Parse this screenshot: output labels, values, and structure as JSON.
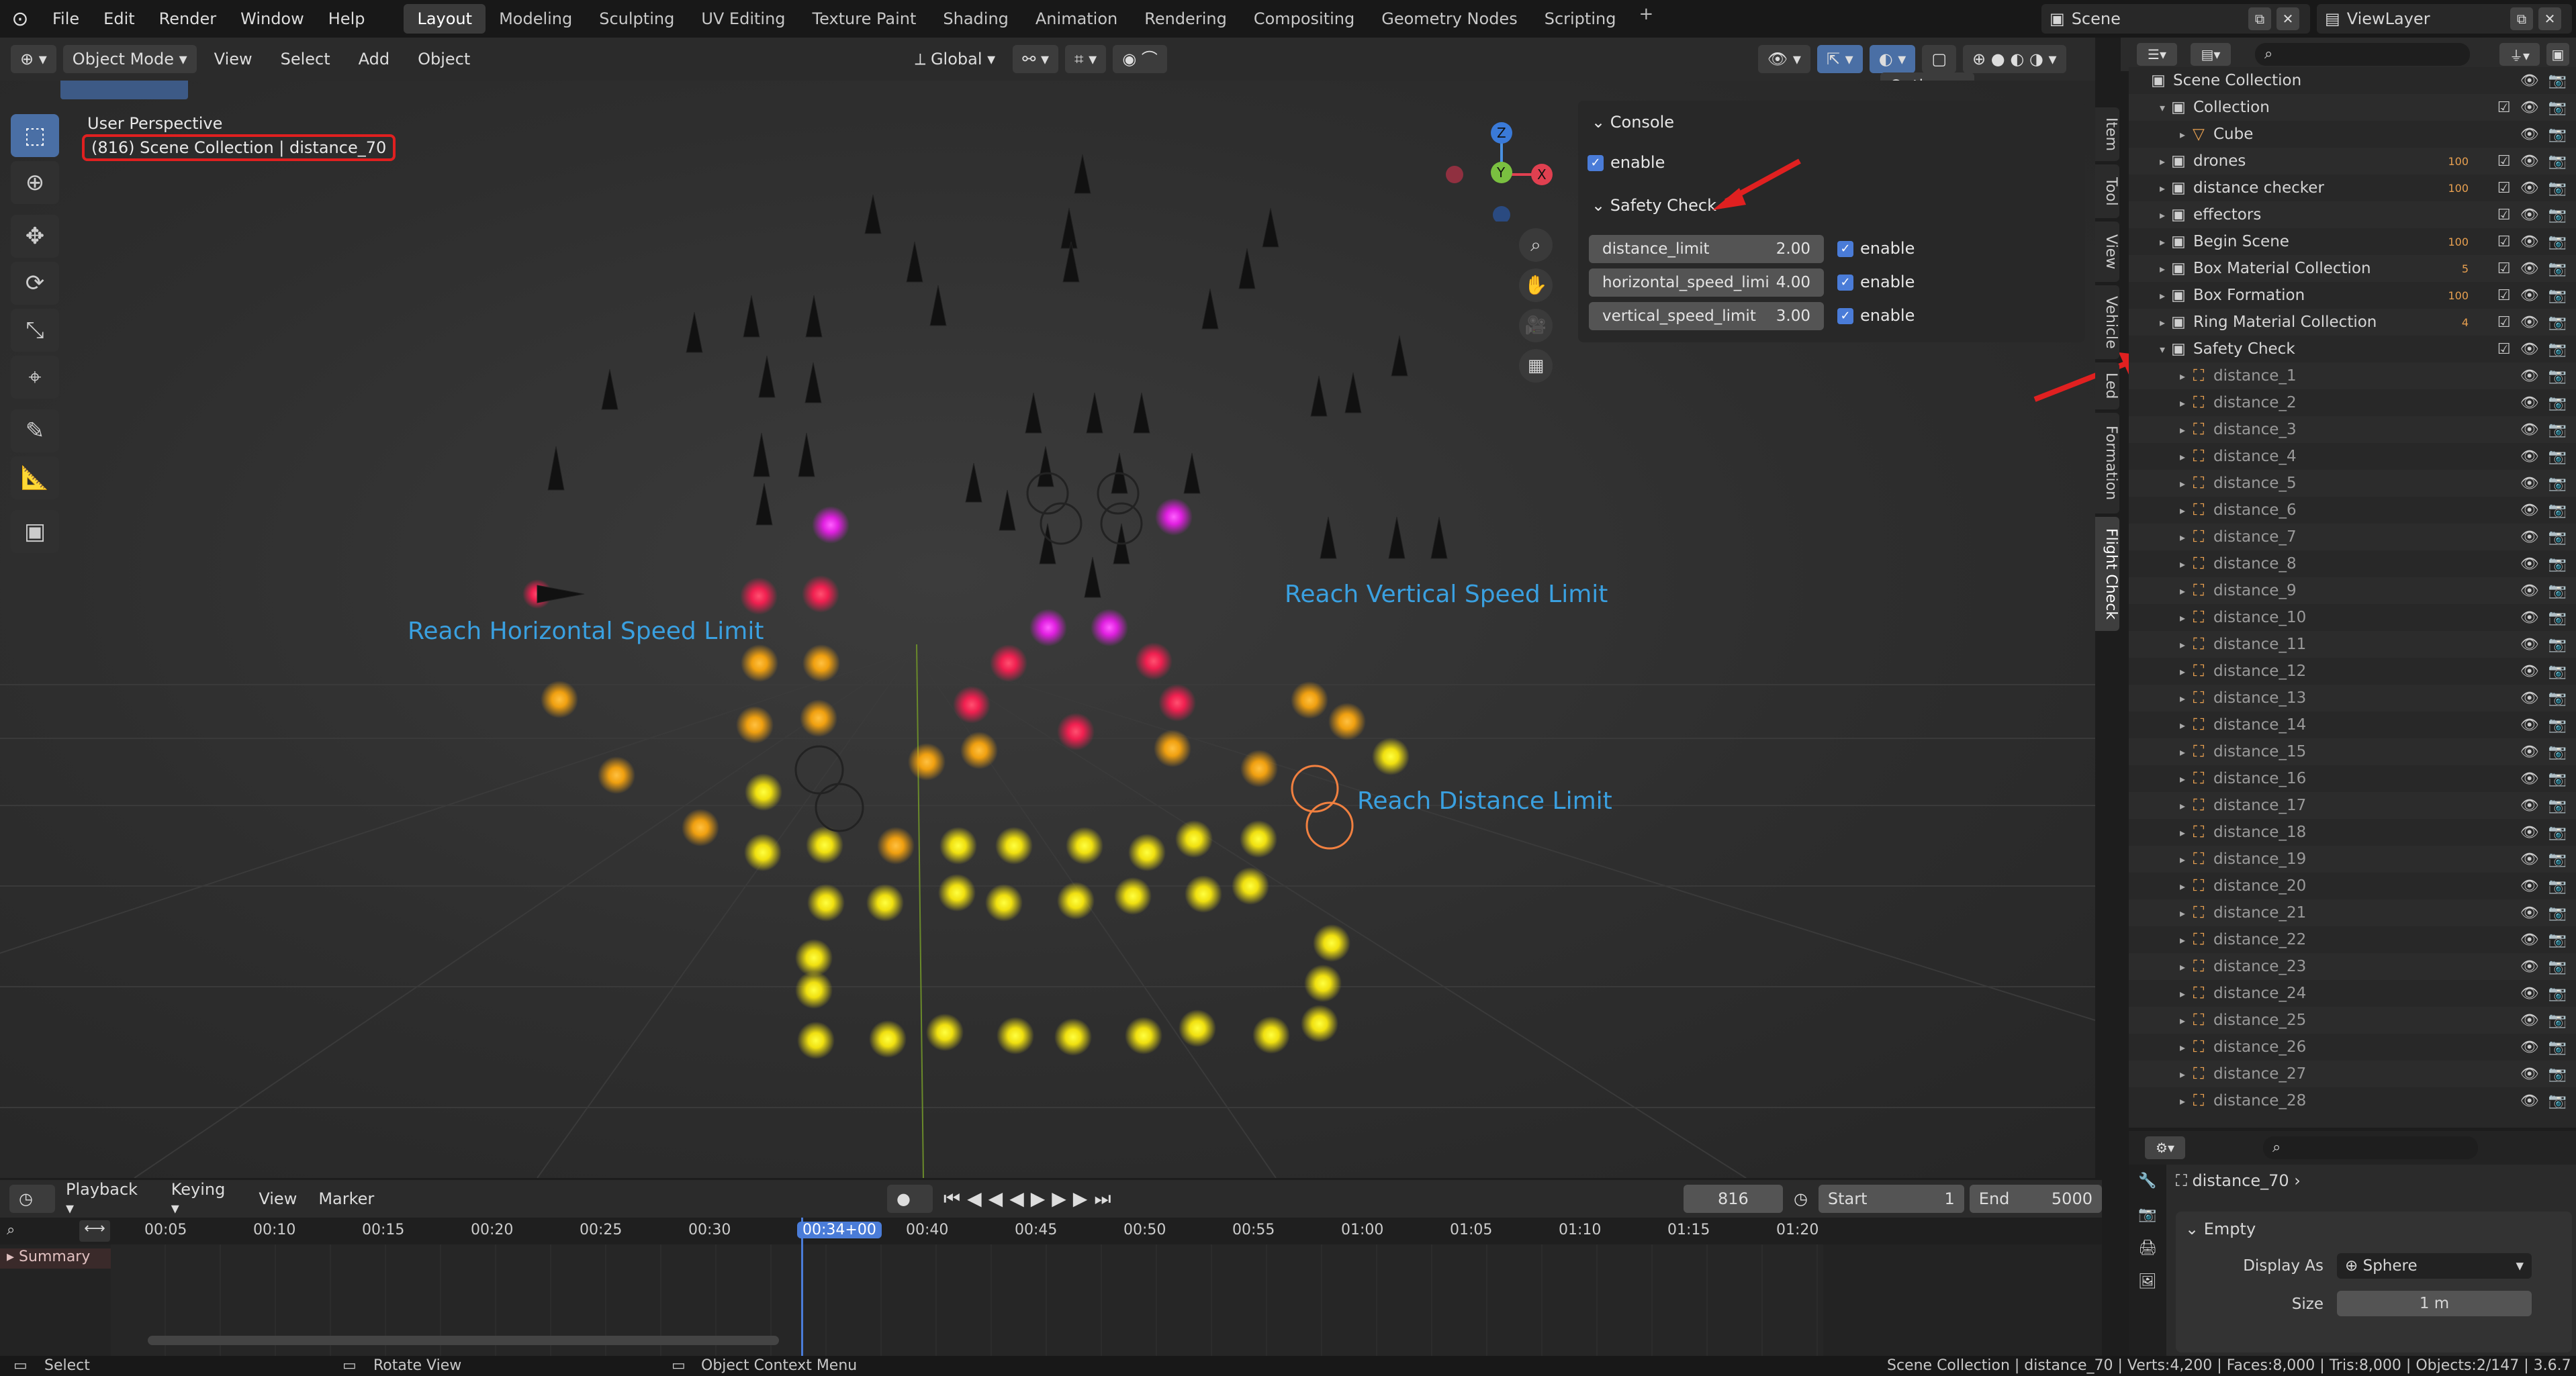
{
  "topbar": {
    "menus": [
      "File",
      "Edit",
      "Render",
      "Window",
      "Help"
    ],
    "workspaces": [
      "Layout",
      "Modeling",
      "Sculpting",
      "UV Editing",
      "Texture Paint",
      "Shading",
      "Animation",
      "Rendering",
      "Compositing",
      "Geometry Nodes",
      "Scripting"
    ],
    "active_workspace": "Layout",
    "scene": "Scene",
    "view_layer": "ViewLayer"
  },
  "viewport_header": {
    "mode": "Object Mode",
    "menus": [
      "View",
      "Select",
      "Add",
      "Object"
    ],
    "transform_orientation": "Global",
    "options": "Options"
  },
  "viewport": {
    "perspective_label": "User Perspective",
    "context_label": "(816) Scene Collection | distance_70",
    "annotations": [
      "Reach Horizontal Speed Limit",
      "Reach Vertical Speed Limit",
      "Reach Distance Limit"
    ],
    "gizmo_axes": [
      "Z",
      "Y",
      "X"
    ]
  },
  "npanel": {
    "console_title": "Console",
    "console_enable": "enable",
    "safety_title": "Safety Check",
    "fields": [
      {
        "label": "distance_limit",
        "value": "2.00",
        "enable": "enable"
      },
      {
        "label": "horizontal_speed_limi",
        "value": "4.00",
        "enable": "enable"
      },
      {
        "label": "vertical_speed_limit",
        "value": "3.00",
        "enable": "enable"
      }
    ],
    "side_tabs": [
      "Item",
      "Tool",
      "View",
      "Vehicle",
      "Led",
      "Formation",
      "Flight Check"
    ]
  },
  "outliner": {
    "rows": [
      {
        "name": "Scene Collection",
        "level": 0,
        "badge": ""
      },
      {
        "name": "Collection",
        "level": 1,
        "badge": ""
      },
      {
        "name": "Cube",
        "level": 2,
        "badge": ""
      },
      {
        "name": "drones",
        "level": 1,
        "badge": "100"
      },
      {
        "name": "distance checker",
        "level": 1,
        "badge": "100"
      },
      {
        "name": "effectors",
        "level": 1,
        "badge": ""
      },
      {
        "name": "Begin Scene",
        "level": 1,
        "badge": "100"
      },
      {
        "name": "Box Material Collection",
        "level": 1,
        "badge": "5"
      },
      {
        "name": "Box Formation",
        "level": 1,
        "badge": "100"
      },
      {
        "name": "Ring Material Collection",
        "level": 1,
        "badge": "4"
      },
      {
        "name": "Safety Check",
        "level": 1,
        "badge": ""
      },
      {
        "name": "distance_1",
        "level": 2,
        "badge": ""
      },
      {
        "name": "distance_2",
        "level": 2,
        "badge": ""
      },
      {
        "name": "distance_3",
        "level": 2,
        "badge": ""
      },
      {
        "name": "distance_4",
        "level": 2,
        "badge": ""
      },
      {
        "name": "distance_5",
        "level": 2,
        "badge": ""
      },
      {
        "name": "distance_6",
        "level": 2,
        "badge": ""
      },
      {
        "name": "distance_7",
        "level": 2,
        "badge": ""
      },
      {
        "name": "distance_8",
        "level": 2,
        "badge": ""
      },
      {
        "name": "distance_9",
        "level": 2,
        "badge": ""
      },
      {
        "name": "distance_10",
        "level": 2,
        "badge": ""
      },
      {
        "name": "distance_11",
        "level": 2,
        "badge": ""
      },
      {
        "name": "distance_12",
        "level": 2,
        "badge": ""
      },
      {
        "name": "distance_13",
        "level": 2,
        "badge": ""
      },
      {
        "name": "distance_14",
        "level": 2,
        "badge": ""
      },
      {
        "name": "distance_15",
        "level": 2,
        "badge": ""
      },
      {
        "name": "distance_16",
        "level": 2,
        "badge": ""
      },
      {
        "name": "distance_17",
        "level": 2,
        "badge": ""
      },
      {
        "name": "distance_18",
        "level": 2,
        "badge": ""
      },
      {
        "name": "distance_19",
        "level": 2,
        "badge": ""
      },
      {
        "name": "distance_20",
        "level": 2,
        "badge": ""
      },
      {
        "name": "distance_21",
        "level": 2,
        "badge": ""
      },
      {
        "name": "distance_22",
        "level": 2,
        "badge": ""
      },
      {
        "name": "distance_23",
        "level": 2,
        "badge": ""
      },
      {
        "name": "distance_24",
        "level": 2,
        "badge": ""
      },
      {
        "name": "distance_25",
        "level": 2,
        "badge": ""
      },
      {
        "name": "distance_26",
        "level": 2,
        "badge": ""
      },
      {
        "name": "distance_27",
        "level": 2,
        "badge": ""
      },
      {
        "name": "distance_28",
        "level": 2,
        "badge": ""
      }
    ]
  },
  "properties": {
    "object_name": "distance_70",
    "section": "Empty",
    "display_as_label": "Display As",
    "display_as_value": "Sphere",
    "size_label": "Size",
    "size_value": "1 m"
  },
  "timeline": {
    "menus": [
      "Playback",
      "Keying",
      "View",
      "Marker"
    ],
    "current_frame": "816",
    "start_label": "Start",
    "start_value": "1",
    "end_label": "End",
    "end_value": "5000",
    "ticks": [
      "00:05",
      "00:10",
      "00:15",
      "00:20",
      "00:25",
      "00:30",
      "00:34+00",
      "00:40",
      "00:45",
      "00:50",
      "00:55",
      "01:00",
      "01:05",
      "01:10",
      "01:15",
      "01:20"
    ],
    "summary": "Summary"
  },
  "statusbar": {
    "select": "Select",
    "rotate": "Rotate View",
    "context": "Object Context Menu",
    "stats": "Scene Collection | distance_70 | Verts:4,200 | Faces:8,000 | Tris:8,000 | Objects:2/147 | 3.6.7"
  },
  "colors": {
    "accent": "#4a7cd8",
    "annotation": "#3aa0e0",
    "highlight": "#e02020"
  }
}
